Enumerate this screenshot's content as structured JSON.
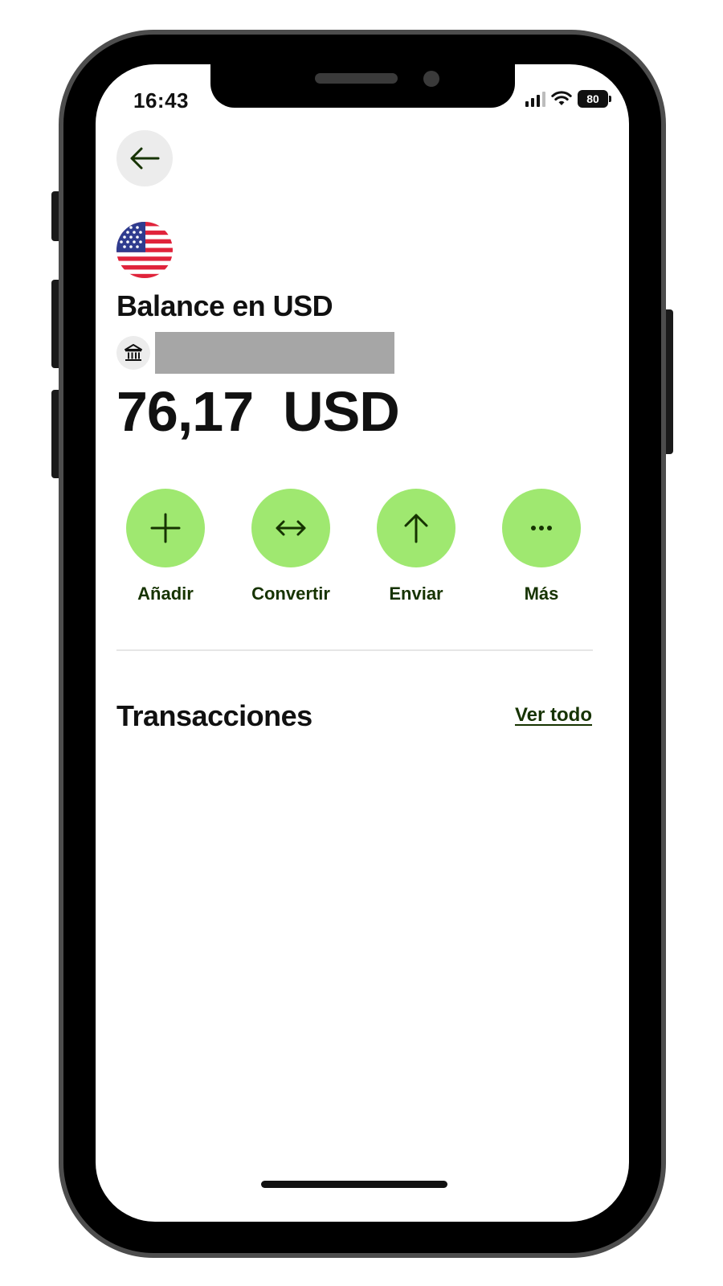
{
  "status_bar": {
    "time": "16:43",
    "battery": "80",
    "icons": [
      "signal-icon",
      "wifi-icon",
      "battery-icon"
    ]
  },
  "header": {
    "back_icon": "arrow-left-icon"
  },
  "balance": {
    "flag_icon": "us-flag-icon",
    "title": "Balance en USD",
    "bank_icon": "bank-icon",
    "amount": "76,17  USD"
  },
  "actions": [
    {
      "label": "Añadir",
      "icon": "plus-icon"
    },
    {
      "label": "Convertir",
      "icon": "swap-arrows-icon"
    },
    {
      "label": "Enviar",
      "icon": "arrow-up-icon"
    },
    {
      "label": "Más",
      "icon": "more-dots-icon"
    }
  ],
  "transactions": {
    "title": "Transacciones",
    "see_all": "Ver todo"
  },
  "colors": {
    "accent": "#9fe870",
    "accent_text": "#163300",
    "text": "#111111",
    "frame": "#4d4d4d"
  }
}
